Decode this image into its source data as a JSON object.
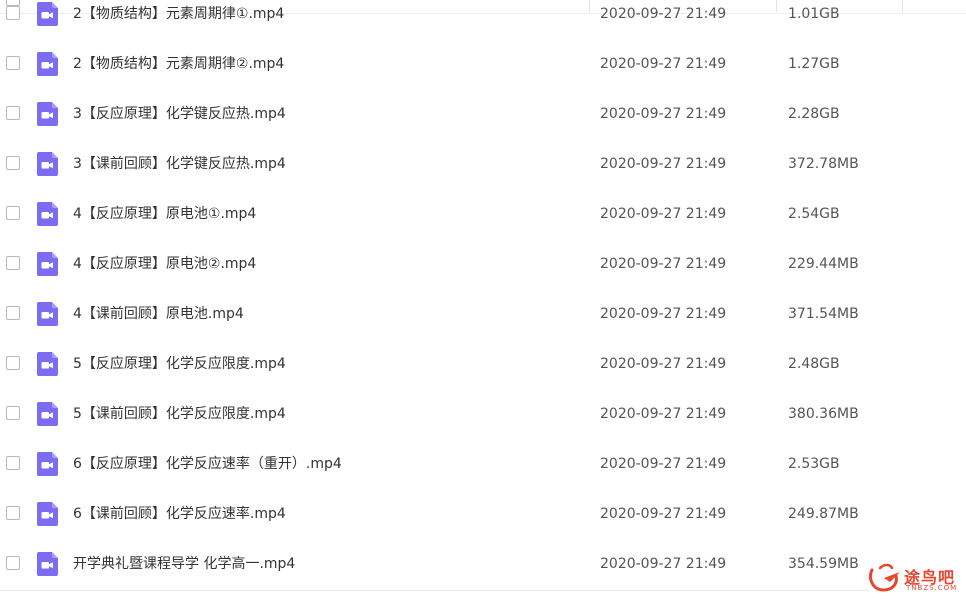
{
  "files": [
    {
      "name": "2【物质结构】元素周期律①.mp4",
      "time": "2020-09-27 21:49",
      "size": "1.01GB"
    },
    {
      "name": "2【物质结构】元素周期律②.mp4",
      "time": "2020-09-27 21:49",
      "size": "1.27GB"
    },
    {
      "name": "3【反应原理】化学键反应热.mp4",
      "time": "2020-09-27 21:49",
      "size": "2.28GB"
    },
    {
      "name": "3【课前回顾】化学键反应热.mp4",
      "time": "2020-09-27 21:49",
      "size": "372.78MB"
    },
    {
      "name": "4【反应原理】原电池①.mp4",
      "time": "2020-09-27 21:49",
      "size": "2.54GB"
    },
    {
      "name": "4【反应原理】原电池②.mp4",
      "time": "2020-09-27 21:49",
      "size": "229.44MB"
    },
    {
      "name": "4【课前回顾】原电池.mp4",
      "time": "2020-09-27 21:49",
      "size": "371.54MB"
    },
    {
      "name": "5【反应原理】化学反应限度.mp4",
      "time": "2020-09-27 21:49",
      "size": "2.48GB"
    },
    {
      "name": "5【课前回顾】化学反应限度.mp4",
      "time": "2020-09-27 21:49",
      "size": "380.36MB"
    },
    {
      "name": "6【反应原理】化学反应速率（重开）.mp4",
      "time": "2020-09-27 21:49",
      "size": "2.53GB"
    },
    {
      "name": "6【课前回顾】化学反应速率.mp4",
      "time": "2020-09-27 21:49",
      "size": "249.87MB"
    },
    {
      "name": "开学典礼暨课程导学 化学高一.mp4",
      "time": "2020-09-27 21:49",
      "size": "354.59MB"
    }
  ],
  "icon": {
    "name": "video-file-icon",
    "color": "#7b6cf2"
  },
  "watermark": {
    "text": "途鸟吧",
    "sub": "TNBZS.COM",
    "color": "#e8452c"
  }
}
